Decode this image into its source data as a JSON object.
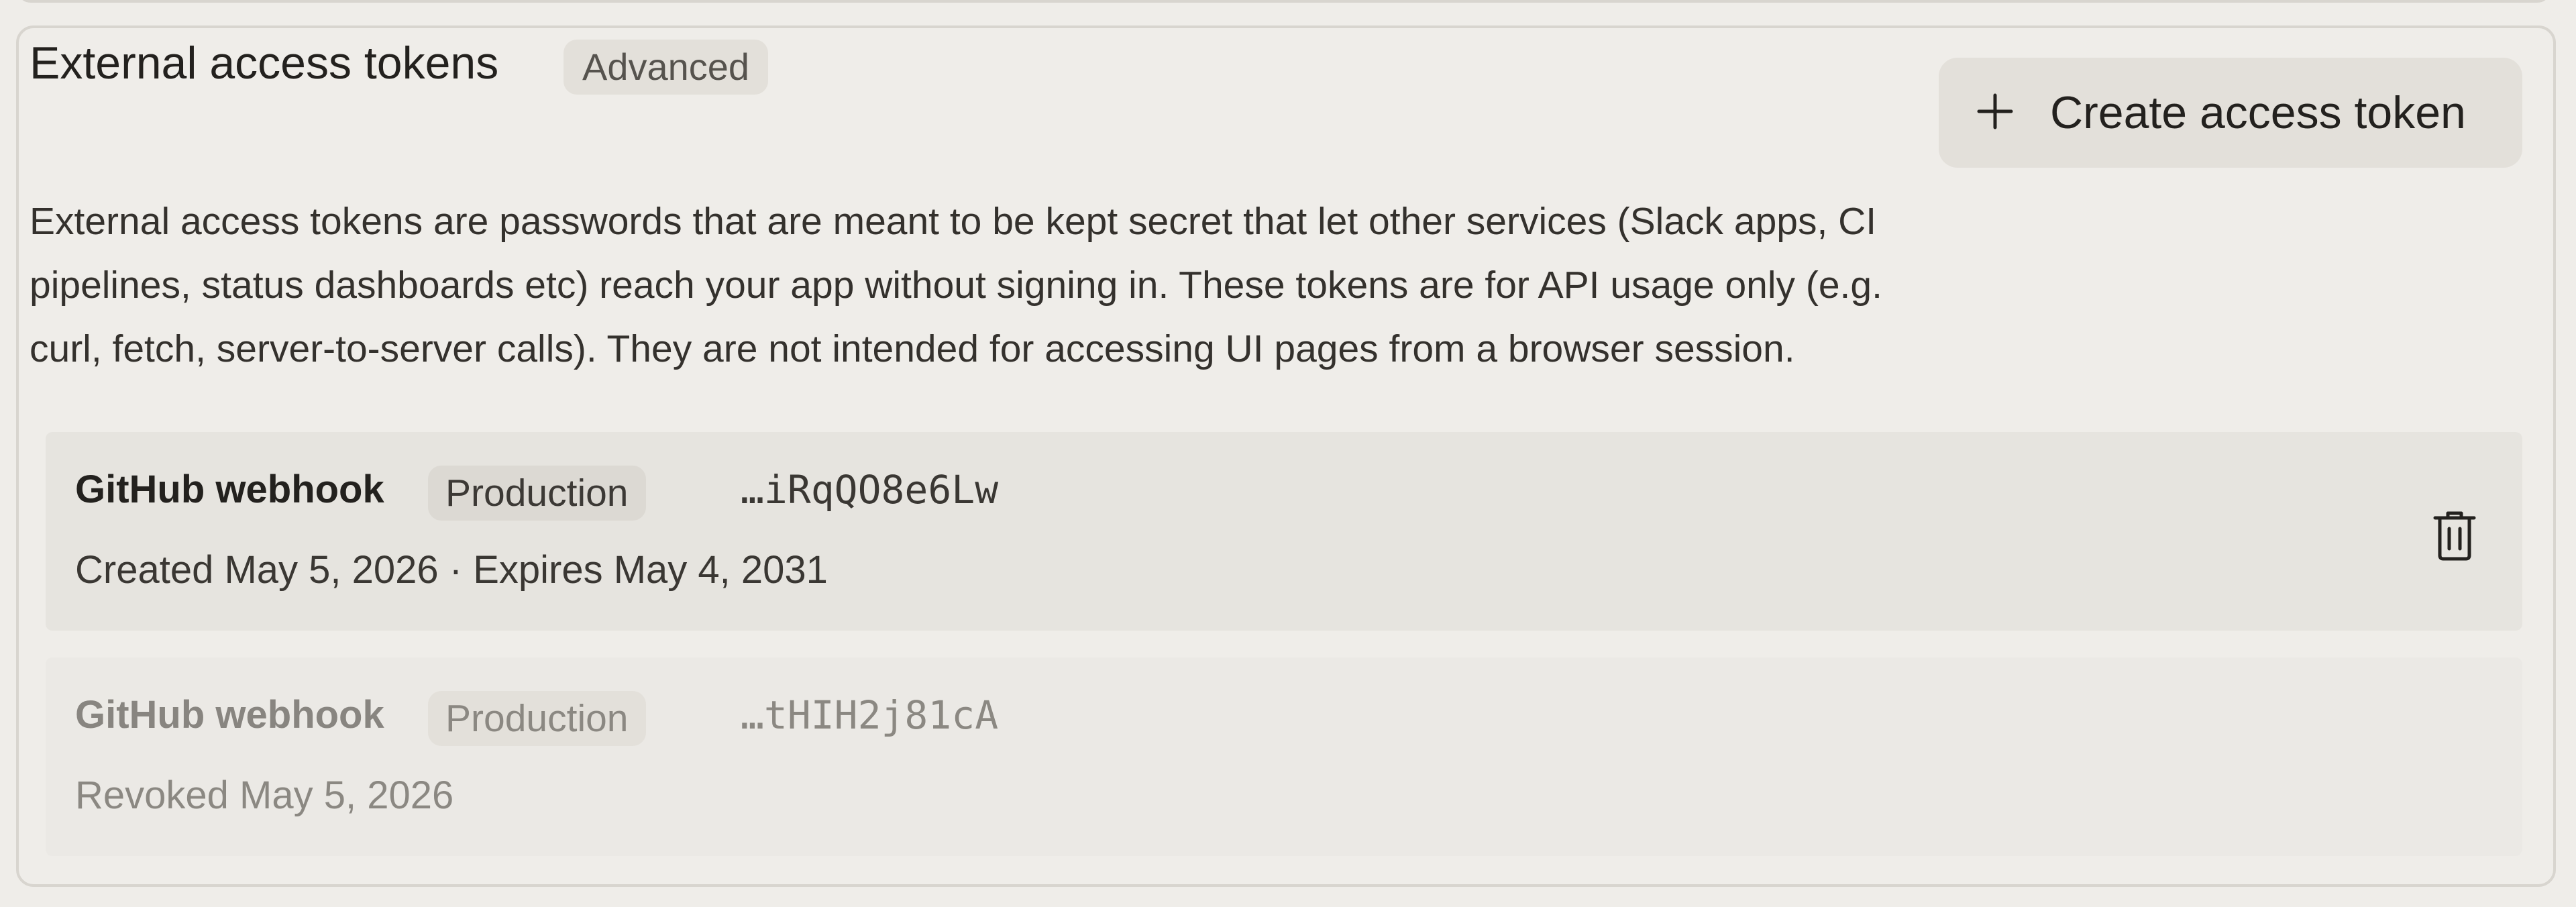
{
  "section": {
    "title": "External access tokens",
    "badge": "Advanced",
    "description": "External access tokens are passwords that are meant to be kept secret that let other services (Slack apps, CI pipelines, status dashboards etc) reach your app without signing in. These tokens are for API usage only (e.g. curl, fetch, server-to-server calls). They are not intended for accessing UI pages from a browser session.",
    "create_button": {
      "label": "Create access token",
      "icon": "plus-icon"
    }
  },
  "tokens": [
    {
      "name": "GitHub webhook",
      "environment": "Production",
      "suffix": "…iRqQO8e6Lw",
      "meta": "Created May 5, 2026 · Expires May 4, 2031",
      "status": "active",
      "action_icon": "trash-icon"
    },
    {
      "name": "GitHub webhook",
      "environment": "Production",
      "suffix": "…tHIH2j81cA",
      "meta": "Revoked May 5, 2026",
      "status": "revoked"
    }
  ],
  "colors": {
    "background": "#efede9",
    "border": "#d8d5cf",
    "badge_background": "#e3e0da",
    "active_row": "#e6e4df",
    "revoked_text": "#8b8882"
  }
}
